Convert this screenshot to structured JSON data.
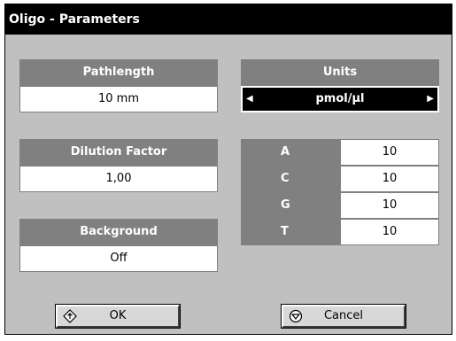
{
  "window": {
    "title": "Oligo - Parameters"
  },
  "pathlength": {
    "label": "Pathlength",
    "value": "10 mm"
  },
  "dilution": {
    "label": "Dilution Factor",
    "value": "1,00"
  },
  "background": {
    "label": "Background",
    "value": "Off"
  },
  "units": {
    "label": "Units",
    "value": "pmol/µl",
    "left_arrow": "◀",
    "right_arrow": "▶"
  },
  "bases": [
    {
      "label": "A",
      "value": "10"
    },
    {
      "label": "C",
      "value": "10"
    },
    {
      "label": "G",
      "value": "10"
    },
    {
      "label": "T",
      "value": "10"
    }
  ],
  "buttons": {
    "ok": "OK",
    "cancel": "Cancel"
  },
  "icons": {
    "ok": "diamond-arrow-icon",
    "cancel": "circle-arrow-icon"
  }
}
